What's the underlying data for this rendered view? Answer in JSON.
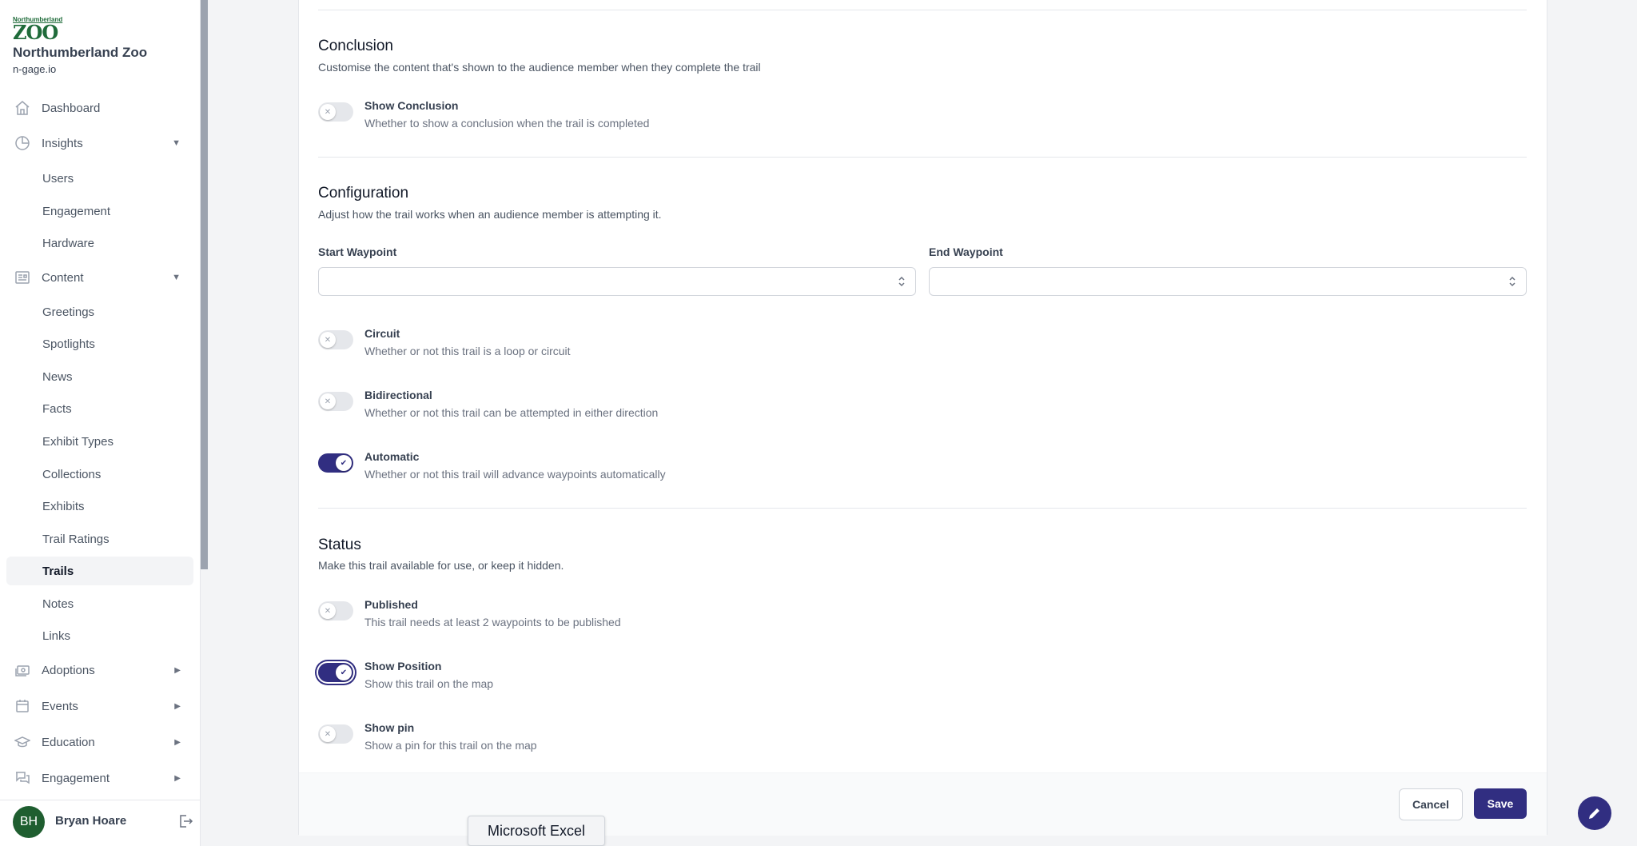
{
  "org": {
    "logo_top": "Northumberland",
    "logo_big": "ZOO",
    "name": "Northumberland Zoo",
    "domain": "n-gage.io"
  },
  "sidebar": {
    "dashboard": "Dashboard",
    "insights": "Insights",
    "insights_children": [
      "Users",
      "Engagement",
      "Hardware"
    ],
    "content": "Content",
    "content_children": [
      "Greetings",
      "Spotlights",
      "News",
      "Facts",
      "Exhibit Types",
      "Collections",
      "Exhibits",
      "Trail Ratings",
      "Trails",
      "Notes",
      "Links"
    ],
    "active": "Trails",
    "adoptions": "Adoptions",
    "events": "Events",
    "education": "Education",
    "engagement": "Engagement"
  },
  "user": {
    "initials": "BH",
    "name": "Bryan Hoare"
  },
  "conclusion": {
    "title": "Conclusion",
    "description": "Customise the content that's shown to the audience member when they complete the trail",
    "show_label": "Show Conclusion",
    "show_desc": "Whether to show a conclusion when the trail is completed",
    "show_on": false
  },
  "configuration": {
    "title": "Configuration",
    "description": "Adjust how the trail works when an audience member is attempting it.",
    "start_label": "Start Waypoint",
    "start_value": "",
    "end_label": "End Waypoint",
    "end_value": "",
    "circuit_label": "Circuit",
    "circuit_desc": "Whether or not this trail is a loop or circuit",
    "circuit_on": false,
    "bidi_label": "Bidirectional",
    "bidi_desc": "Whether or not this trail can be attempted in either direction",
    "bidi_on": false,
    "auto_label": "Automatic",
    "auto_desc": "Whether or not this trail will advance waypoints automatically",
    "auto_on": true
  },
  "status": {
    "title": "Status",
    "description": "Make this trail available for use, or keep it hidden.",
    "published_label": "Published",
    "published_desc": "This trail needs at least 2 waypoints to be published",
    "published_on": false,
    "position_label": "Show Position",
    "position_desc": "Show this trail on the map",
    "position_on": true,
    "pin_label": "Show pin",
    "pin_desc": "Show a pin for this trail on the map",
    "pin_on": false
  },
  "actions": {
    "cancel": "Cancel",
    "save": "Save"
  },
  "tooltip": "Microsoft Excel",
  "colors": {
    "accent": "#312e81",
    "logo_green": "#1f6b3a",
    "avatar_green": "#1f5e30"
  }
}
